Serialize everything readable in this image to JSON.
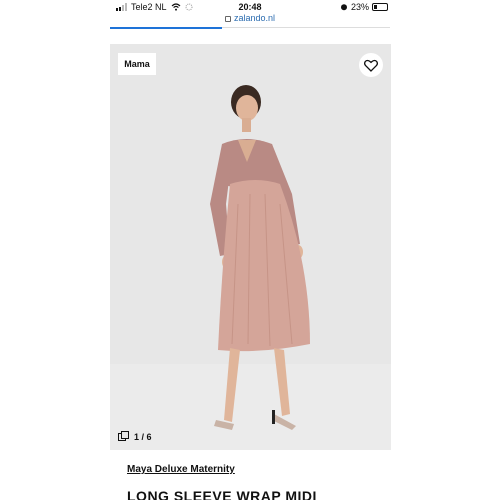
{
  "status_bar": {
    "carrier": "Tele2 NL",
    "time": "20:48",
    "battery": "23%"
  },
  "browser": {
    "url": "zalando.nl",
    "load_progress": 0.4
  },
  "product": {
    "badge": "Mama",
    "image_counter": "1 / 6",
    "brand": "Maya Deluxe Maternity",
    "title": "LONG SLEEVE WRAP MIDI"
  },
  "colors": {
    "accent": "#1e73d8",
    "photo_bg": "#e7e7e7",
    "dress": "#d4a599"
  },
  "icons": [
    "signal-icon",
    "wifi-icon",
    "alarm-icon",
    "battery-icon",
    "lock-icon",
    "heart-icon",
    "gallery-icon"
  ]
}
